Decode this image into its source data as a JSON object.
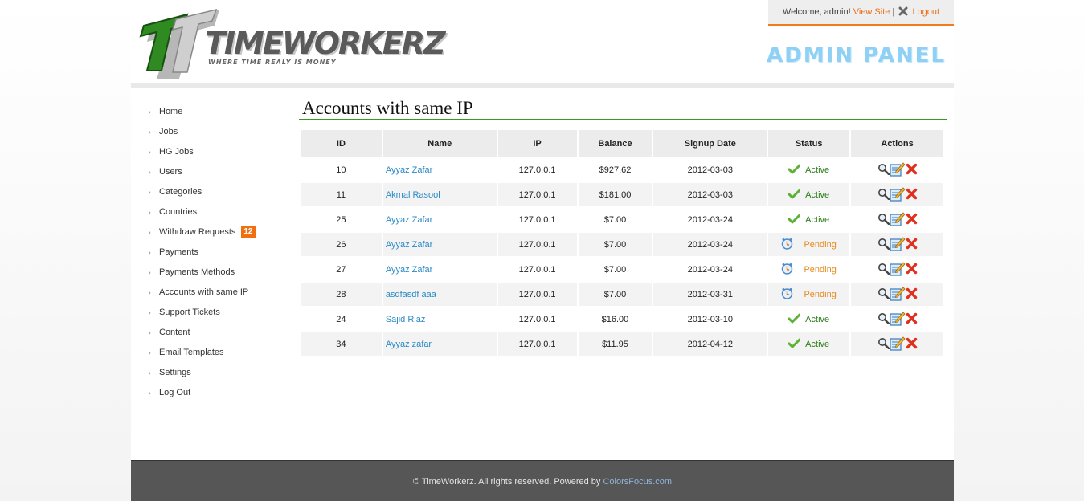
{
  "header": {
    "logo_text": "TIMEWORKERZ",
    "tagline": "WHERE TIME REALY IS MONEY",
    "welcome": "Welcome, admin!",
    "view_site": "View Site",
    "separator": "|",
    "logout": "Logout",
    "admin_panel": "ADMIN PANEL"
  },
  "sidebar": {
    "items": [
      {
        "label": "Home"
      },
      {
        "label": "Jobs"
      },
      {
        "label": "HG Jobs"
      },
      {
        "label": "Users"
      },
      {
        "label": "Categories"
      },
      {
        "label": "Countries"
      },
      {
        "label": "Withdraw Requests",
        "badge": "12"
      },
      {
        "label": "Payments"
      },
      {
        "label": "Payments Methods"
      },
      {
        "label": "Accounts with same IP"
      },
      {
        "label": "Support Tickets"
      },
      {
        "label": "Content"
      },
      {
        "label": "Email Templates"
      },
      {
        "label": "Settings"
      },
      {
        "label": "Log Out"
      }
    ]
  },
  "main": {
    "title": "Accounts with same IP",
    "columns": [
      "ID",
      "Name",
      "IP",
      "Balance",
      "Signup Date",
      "Status",
      "Actions"
    ],
    "rows": [
      {
        "id": "10",
        "name": "Ayyaz Zafar",
        "ip": "127.0.0.1",
        "balance": "$927.62",
        "date": "2012-03-03",
        "status": "Active"
      },
      {
        "id": "11",
        "name": "Akmal Rasool",
        "ip": "127.0.0.1",
        "balance": "$181.00",
        "date": "2012-03-03",
        "status": "Active"
      },
      {
        "id": "25",
        "name": "Ayyaz Zafar",
        "ip": "127.0.0.1",
        "balance": "$7.00",
        "date": "2012-03-24",
        "status": "Active"
      },
      {
        "id": "26",
        "name": "Ayyaz Zafar",
        "ip": "127.0.0.1",
        "balance": "$7.00",
        "date": "2012-03-24",
        "status": "Pending"
      },
      {
        "id": "27",
        "name": "Ayyaz Zafar",
        "ip": "127.0.0.1",
        "balance": "$7.00",
        "date": "2012-03-24",
        "status": "Pending"
      },
      {
        "id": "28",
        "name": "asdfasdf aaa",
        "ip": "127.0.0.1",
        "balance": "$7.00",
        "date": "2012-03-31",
        "status": "Pending"
      },
      {
        "id": "24",
        "name": "Sajid Riaz",
        "ip": "127.0.0.1",
        "balance": "$16.00",
        "date": "2012-03-10",
        "status": "Active"
      },
      {
        "id": "34",
        "name": "Ayyaz zafar",
        "ip": "127.0.0.1",
        "balance": "$11.95",
        "date": "2012-04-12",
        "status": "Active"
      }
    ]
  },
  "footer": {
    "text": "© TimeWorkerz. All rights reserved. Powered by",
    "link": "ColorsFocus.com"
  },
  "colors": {
    "accent_orange": "#f07c1a",
    "title_rule_green": "#3a9a19",
    "link_blue": "#2b8ac6",
    "footer_bg": "#565656"
  },
  "icons": {
    "active": "check-icon",
    "pending": "clock-icon",
    "view": "magnifier-icon",
    "edit": "edit-icon",
    "delete": "delete-icon",
    "logout": "x-icon",
    "sidebar_bullet": "arrow-icon"
  }
}
